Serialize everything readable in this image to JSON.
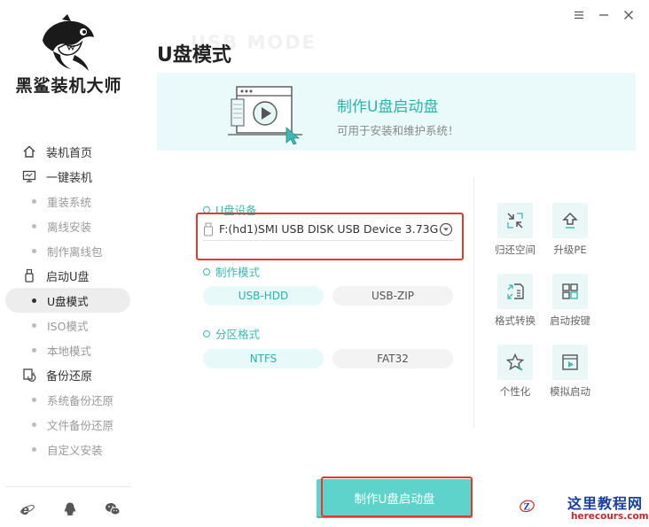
{
  "app": {
    "brand_name": "黑鲨装机大师",
    "page_title": "U盘模式",
    "ghost_title": "USB MODE"
  },
  "window_controls": [
    "menu-icon",
    "minimize-icon",
    "close-icon"
  ],
  "sidebar": {
    "groups": [
      {
        "label": "装机首页",
        "icon": "home-icon",
        "items": []
      },
      {
        "label": "一键装机",
        "icon": "monitor-icon",
        "items": [
          "重装系统",
          "离线安装",
          "制作离线包"
        ]
      },
      {
        "label": "启动U盘",
        "icon": "usb-icon",
        "items": [
          "U盘模式",
          "ISO模式",
          "本地模式"
        ],
        "active_item": "U盘模式"
      },
      {
        "label": "备份还原",
        "icon": "backup-icon",
        "items": [
          "系统备份还原",
          "文件备份还原",
          "自定义安装"
        ]
      }
    ],
    "footer_icons": [
      "ie-browser-icon",
      "qq-icon",
      "wechat-icon"
    ]
  },
  "banner": {
    "title": "制作U盘启动盘",
    "subtitle": "可用于安装和维护系统！"
  },
  "form": {
    "device_label": "U盘设备",
    "device_value": "F:(hd1)SMI USB DISK USB Device 3.73GB",
    "mode_label": "制作模式",
    "mode_options": [
      "USB-HDD",
      "USB-ZIP"
    ],
    "mode_selected": "USB-HDD",
    "partition_label": "分区格式",
    "partition_options": [
      "NTFS",
      "FAT32"
    ],
    "partition_selected": "NTFS"
  },
  "tools": [
    {
      "label": "归还空间",
      "icon": "shrink-arrows-icon"
    },
    {
      "label": "升级PE",
      "icon": "upgrade-arrow-icon"
    },
    {
      "label": "格式转换",
      "icon": "format-convert-icon"
    },
    {
      "label": "启动按键",
      "icon": "keyboard-keys-icon"
    },
    {
      "label": "个性化",
      "icon": "personalize-star-icon"
    },
    {
      "label": "模拟启动",
      "icon": "simulate-play-icon"
    }
  ],
  "primary_button": {
    "label": "制作U盘启动盘"
  },
  "watermark": {
    "title": "这里教程网",
    "url": "herecours.com"
  },
  "colors": {
    "accent": "#3bb9b2",
    "button": "#5dd3cc",
    "highlight_box": "#e23a32",
    "banner_bg": "#eafafa"
  }
}
